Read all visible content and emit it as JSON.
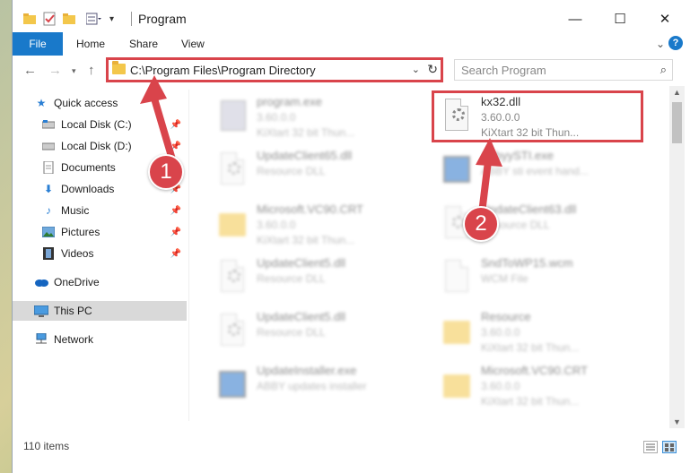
{
  "window": {
    "title": "Program"
  },
  "ribbon": {
    "tabs": [
      "File",
      "Home",
      "Share",
      "View"
    ],
    "help": "?"
  },
  "nav": {
    "address": "C:\\Program Files\\Program Directory",
    "search_placeholder": "Search Program"
  },
  "sidebar": {
    "items": [
      {
        "label": "Quick access",
        "icon": "star-icon"
      },
      {
        "label": "Local Disk (C:)",
        "icon": "drive-icon"
      },
      {
        "label": "Local Disk (D:)",
        "icon": "drive-icon"
      },
      {
        "label": "Documents",
        "icon": "documents-icon"
      },
      {
        "label": "Downloads",
        "icon": "download-icon"
      },
      {
        "label": "Music",
        "icon": "music-icon"
      },
      {
        "label": "Pictures",
        "icon": "pictures-icon"
      },
      {
        "label": "Videos",
        "icon": "video-icon"
      },
      {
        "label": "OneDrive",
        "icon": "cloud-icon"
      },
      {
        "label": "This PC",
        "icon": "computer-icon"
      },
      {
        "label": "Network",
        "icon": "network-icon"
      }
    ]
  },
  "files": [
    {
      "name": "program.exe",
      "meta1": "3.60.0.0",
      "meta2": "KiXtart 32 bit Thun...",
      "icon": "exe-icon"
    },
    {
      "name": "kx32.dll",
      "meta1": "3.60.0.0",
      "meta2": "KiXtart 32 bit Thun...",
      "icon": "dll-icon"
    },
    {
      "name": "UpdateClient65.dll",
      "meta1": "Resource DLL",
      "meta2": "",
      "icon": "dll-icon"
    },
    {
      "name": "AbbyySTI.exe",
      "meta1": "ABBY sti event hand...",
      "meta2": "",
      "icon": "app-icon"
    },
    {
      "name": "Microsoft.VC90.CRT",
      "meta1": "3.60.0.0",
      "meta2": "KiXtart 32 bit Thun...",
      "icon": "folder-icon"
    },
    {
      "name": "UpdateClient63.dll",
      "meta1": "Resource DLL",
      "meta2": "",
      "icon": "dll-icon"
    },
    {
      "name": "UpdateClient5.dll",
      "meta1": "Resource DLL",
      "meta2": "",
      "icon": "dll-icon"
    },
    {
      "name": "SndToWP15.wcm",
      "meta1": "WCM File",
      "meta2": "",
      "icon": "file-icon"
    },
    {
      "name": "UpdateClient5.dll",
      "meta1": "Resource DLL",
      "meta2": "",
      "icon": "dll-icon"
    },
    {
      "name": "Resource",
      "meta1": "3.60.0.0",
      "meta2": "KiXtart 32 bit Thun...",
      "icon": "folder-icon"
    },
    {
      "name": "UpdateInstaller.exe",
      "meta1": "ABBY updates installer",
      "meta2": "",
      "icon": "app-icon"
    },
    {
      "name": "Microsoft.VC90.CRT",
      "meta1": "3.60.0.0",
      "meta2": "KiXtart 32 bit Thun...",
      "icon": "folder-icon"
    }
  ],
  "status": {
    "items": "110 items"
  },
  "callouts": [
    "1",
    "2"
  ],
  "colors": {
    "accent": "#1979ca",
    "highlight": "#d9444b",
    "folder": "#f3c74b"
  }
}
